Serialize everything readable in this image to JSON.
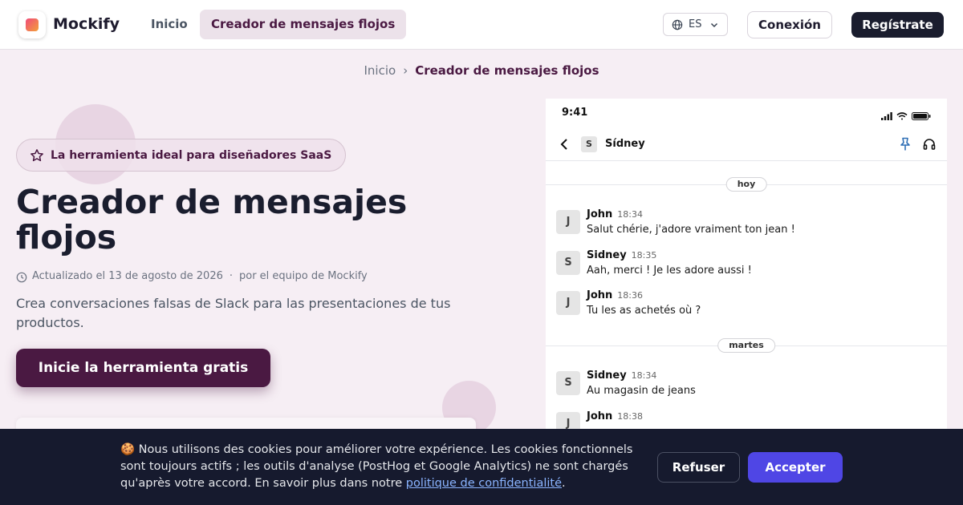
{
  "header": {
    "brand": "Mockify",
    "nav_home": "Inicio",
    "nav_active": "Creador de mensajes flojos",
    "lang_code": "ES",
    "login": "Conexión",
    "register": "Regístrate"
  },
  "breadcrumb": {
    "home": "Inicio",
    "separator": "›",
    "current": "Creador de mensajes flojos"
  },
  "hero": {
    "badge": "La herramienta ideal para diseñadores SaaS",
    "title": "Creador de mensajes flojos",
    "updated": "Actualizado el 13 de agosto de 2026",
    "dot": "·",
    "author": "por el equipo de Mockify",
    "description": "Crea conversaciones falsas de Slack para las presentaciones de tus productos.",
    "cta": "Inicie la herramienta gratis"
  },
  "preview": {
    "time": "9:41",
    "contact_initial": "S",
    "contact_name": "Sídney",
    "days": [
      "hoy",
      "martes"
    ],
    "messages": [
      {
        "initial": "J",
        "name": "John",
        "time": "18:34",
        "text": "Salut chérie, j'adore vraiment ton jean !"
      },
      {
        "initial": "S",
        "name": "Sidney",
        "time": "18:35",
        "text": "Aah, merci ! Je les adore aussi !"
      },
      {
        "initial": "J",
        "name": "John",
        "time": "18:36",
        "text": "Tu les as achetés où ?"
      },
      {
        "initial": "S",
        "name": "Sidney",
        "time": "18:34",
        "text": "Au magasin de jeans"
      },
      {
        "initial": "J",
        "name": "John",
        "time": "18:38",
        "text": ""
      }
    ]
  },
  "cookie": {
    "emoji": "🍪",
    "text": "Nous utilisons des cookies pour améliorer votre expérience. Les cookies fonctionnels sont toujours actifs ; les outils d'analyse (PostHog et Google Analytics) ne sont chargés qu'après votre accord. En savoir plus dans notre",
    "link": "politique de confidentialité",
    "end": ".",
    "refuse": "Refuser",
    "accept": "Accepter"
  },
  "colors": {
    "brand_plum": "#4a1942",
    "accept": "#4f46e5",
    "banner_bg": "#161a2e",
    "page_bg": "#f6eef4"
  },
  "icons": [
    "logo-icon",
    "globe-icon",
    "chevron-down-icon",
    "star-icon",
    "clock-icon",
    "signal-icon",
    "wifi-icon",
    "battery-icon",
    "back-arrow-icon",
    "pin-icon",
    "headset-icon"
  ]
}
